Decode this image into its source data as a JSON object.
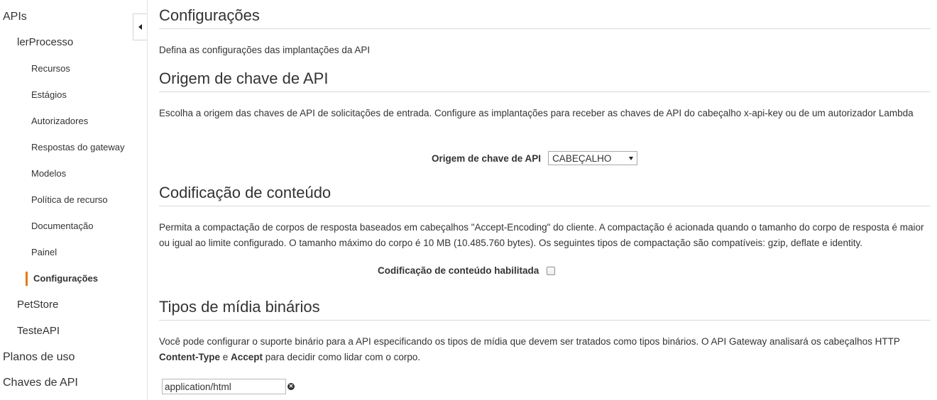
{
  "sidebar": {
    "apis_label": "APIs",
    "api_name": "lerProcesso",
    "items": [
      {
        "label": "Recursos"
      },
      {
        "label": "Estágios"
      },
      {
        "label": "Autorizadores"
      },
      {
        "label": "Respostas do gateway"
      },
      {
        "label": "Modelos"
      },
      {
        "label": "Política de recurso"
      },
      {
        "label": "Documentação"
      },
      {
        "label": "Painel"
      },
      {
        "label": "Configurações"
      }
    ],
    "other_apis": [
      "PetStore",
      "TesteAPI"
    ],
    "usage_plans": "Planos de uso",
    "api_keys": "Chaves de API",
    "active_item": "Configurações",
    "accent_color": "#e47911"
  },
  "main": {
    "title": "Configurações",
    "subtitle": "Defina as configurações das implantações da API",
    "api_key_source": {
      "heading": "Origem de chave de API",
      "description": "Escolha a origem das chaves de API de solicitações de entrada. Configure as implantações para receber as chaves de API do cabeçalho x-api-key ou de um autorizador Lambda",
      "field_label": "Origem de chave de API",
      "selected_value": "CABEÇALHO"
    },
    "content_encoding": {
      "heading": "Codificação de conteúdo",
      "description": "Permita a compactação de corpos de resposta baseados em cabeçalhos \"Accept-Encoding\" do cliente. A compactação é acionada quando o tamanho do corpo de resposta é maior ou igual ao limite configurado. O tamanho máximo do corpo é 10 MB (10.485.760 bytes). Os seguintes tipos de compactação são compatíveis: gzip, deflate e identity.",
      "checkbox_label": "Codificação de conteúdo habilitada",
      "checked": false
    },
    "binary_media": {
      "heading": "Tipos de mídia binários",
      "desc_part1": "Você pode configurar o suporte binário para a API especificando os tipos de mídia que devem ser tratados como tipos binários. O API Gateway analisará os cabeçalhos HTTP ",
      "desc_bold1": "Content-Type",
      "desc_part2": " e ",
      "desc_bold2": "Accept",
      "desc_part3": " para decidir como lidar com o corpo.",
      "media_type_value": "application/html"
    }
  }
}
